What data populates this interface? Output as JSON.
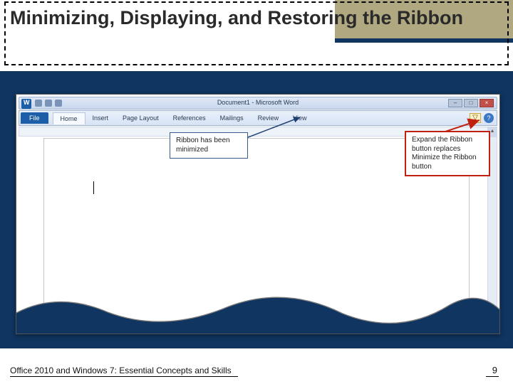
{
  "slide": {
    "title": "Minimizing, Displaying, and Restoring the Ribbon",
    "footer_text": "Office 2010 and Windows 7: Essential Concepts and Skills",
    "page_number": "9"
  },
  "word_window": {
    "doc_title": "Document1 - Microsoft Word",
    "file_tab": "File",
    "tabs": [
      "Home",
      "Insert",
      "Page Layout",
      "References",
      "Mailings",
      "Review",
      "View"
    ],
    "expand_glyph": "▽",
    "help_glyph": "?",
    "min_glyph": "–",
    "max_glyph": "□",
    "close_glyph": "×",
    "scroll_up": "▴",
    "scroll_down": "▾"
  },
  "callouts": {
    "minimized": "Ribbon has been minimized",
    "expand": "Expand the Ribbon button replaces Minimize the Ribbon button"
  }
}
